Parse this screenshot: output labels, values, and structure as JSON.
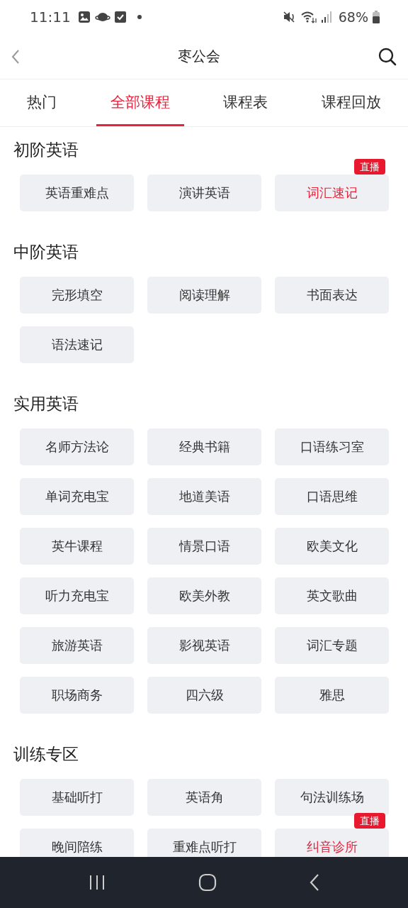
{
  "status_bar": {
    "time": "11:11",
    "battery": "68%"
  },
  "header": {
    "title": "枣公会"
  },
  "tabs": [
    {
      "label": "热门",
      "selected": false
    },
    {
      "label": "全部课程",
      "selected": true
    },
    {
      "label": "课程表",
      "selected": false
    },
    {
      "label": "课程回放",
      "selected": false
    }
  ],
  "sections": [
    {
      "title": "初阶英语",
      "items": [
        {
          "label": "英语重难点",
          "live": false
        },
        {
          "label": "演讲英语",
          "live": false
        },
        {
          "label": "词汇速记",
          "live": true,
          "badge": "直播"
        }
      ]
    },
    {
      "title": "中阶英语",
      "items": [
        {
          "label": "完形填空",
          "live": false
        },
        {
          "label": "阅读理解",
          "live": false
        },
        {
          "label": "书面表达",
          "live": false
        },
        {
          "label": "语法速记",
          "live": false
        }
      ]
    },
    {
      "title": "实用英语",
      "items": [
        {
          "label": "名师方法论",
          "live": false
        },
        {
          "label": "经典书籍",
          "live": false
        },
        {
          "label": "口语练习室",
          "live": false
        },
        {
          "label": "单词充电宝",
          "live": false
        },
        {
          "label": "地道美语",
          "live": false
        },
        {
          "label": "口语思维",
          "live": false
        },
        {
          "label": "英牛课程",
          "live": false
        },
        {
          "label": "情景口语",
          "live": false
        },
        {
          "label": "欧美文化",
          "live": false
        },
        {
          "label": "听力充电宝",
          "live": false
        },
        {
          "label": "欧美外教",
          "live": false
        },
        {
          "label": "英文歌曲",
          "live": false
        },
        {
          "label": "旅游英语",
          "live": false
        },
        {
          "label": "影视英语",
          "live": false
        },
        {
          "label": "词汇专题",
          "live": false
        },
        {
          "label": "职场商务",
          "live": false
        },
        {
          "label": "四六级",
          "live": false
        },
        {
          "label": "雅思",
          "live": false
        }
      ]
    },
    {
      "title": "训练专区",
      "items": [
        {
          "label": "基础听打",
          "live": false
        },
        {
          "label": "英语角",
          "live": false
        },
        {
          "label": "句法训练场",
          "live": false
        },
        {
          "label": "晚间陪练",
          "live": false
        },
        {
          "label": "重难点听打",
          "live": false
        },
        {
          "label": "纠音诊所",
          "live": true,
          "badge": "直播"
        }
      ]
    }
  ]
}
